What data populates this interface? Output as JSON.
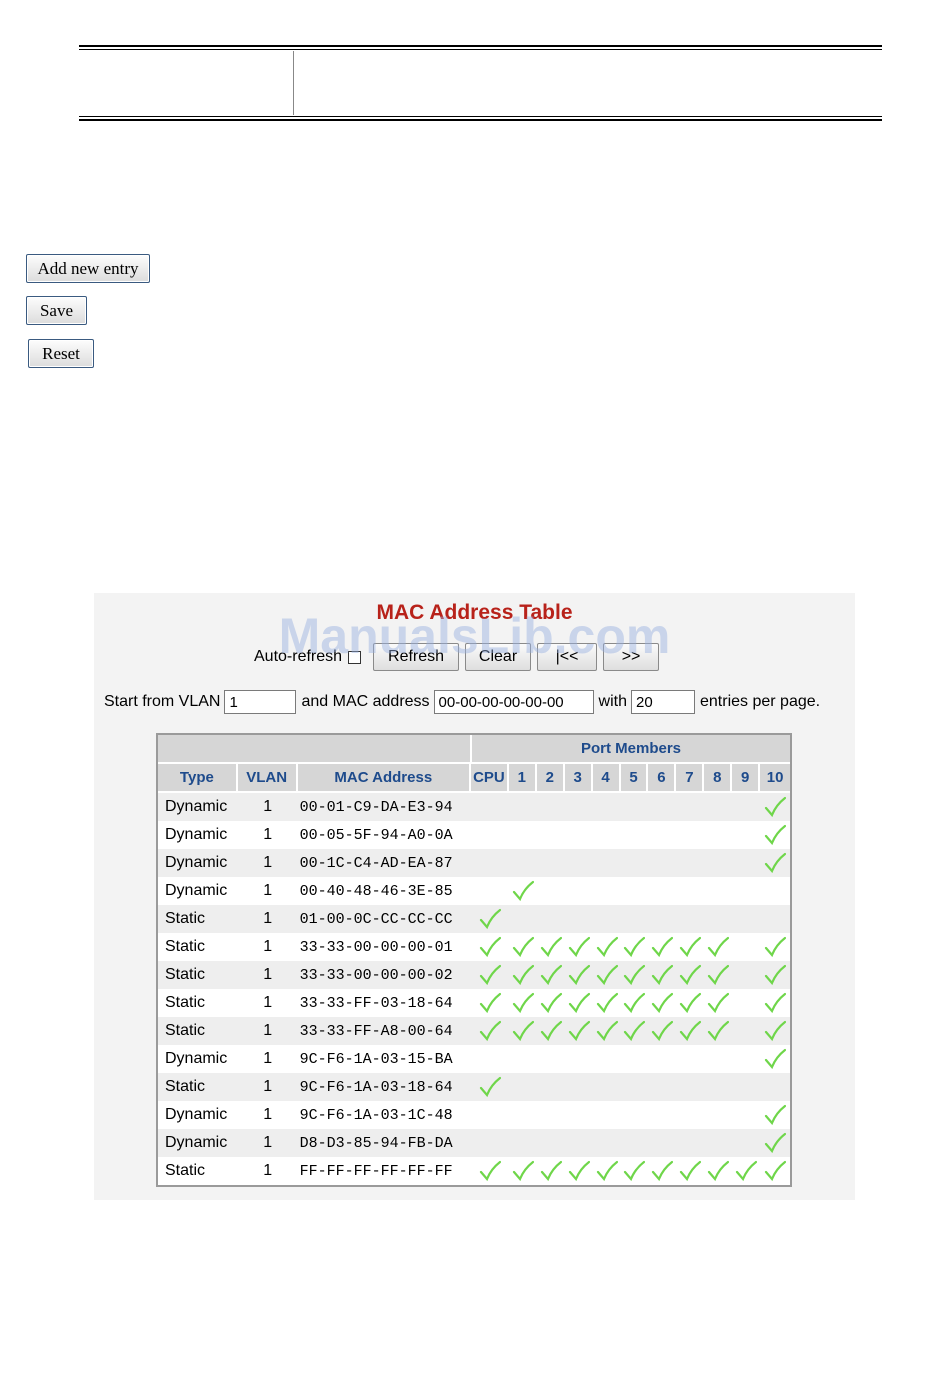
{
  "doc_buttons": {
    "add_new_entry": "Add new entry",
    "save": "Save",
    "reset": "Reset"
  },
  "panel": {
    "title": "MAC Address Table",
    "watermark": "ManualsLib.com",
    "auto_refresh_label": "Auto-refresh",
    "auto_refresh_checked": false,
    "buttons": {
      "refresh": "Refresh",
      "clear": "Clear",
      "prev": "|<<",
      "next": ">>"
    },
    "filter": {
      "start_label": "Start from VLAN",
      "vlan_value": "1",
      "mac_label": "and MAC address",
      "mac_value": "00-00-00-00-00-00",
      "with_label": "with",
      "entries_value": "20",
      "entries_label": "entries per page."
    }
  },
  "table": {
    "group_header": "Port Members",
    "columns": [
      "Type",
      "VLAN",
      "MAC Address",
      "CPU",
      "1",
      "2",
      "3",
      "4",
      "5",
      "6",
      "7",
      "8",
      "9",
      "10"
    ],
    "check_color": "#6fd64a",
    "header_text_color": "#1e4b8c",
    "title_color": "#b8221a",
    "rows": [
      {
        "type": "Dynamic",
        "vlan": "1",
        "mac": "00-01-C9-DA-E3-94",
        "ports": [
          0,
          0,
          0,
          0,
          0,
          0,
          0,
          0,
          0,
          0,
          1
        ]
      },
      {
        "type": "Dynamic",
        "vlan": "1",
        "mac": "00-05-5F-94-A0-0A",
        "ports": [
          0,
          0,
          0,
          0,
          0,
          0,
          0,
          0,
          0,
          0,
          1
        ]
      },
      {
        "type": "Dynamic",
        "vlan": "1",
        "mac": "00-1C-C4-AD-EA-87",
        "ports": [
          0,
          0,
          0,
          0,
          0,
          0,
          0,
          0,
          0,
          0,
          1
        ]
      },
      {
        "type": "Dynamic",
        "vlan": "1",
        "mac": "00-40-48-46-3E-85",
        "ports": [
          0,
          1,
          0,
          0,
          0,
          0,
          0,
          0,
          0,
          0,
          0
        ]
      },
      {
        "type": "Static",
        "vlan": "1",
        "mac": "01-00-0C-CC-CC-CC",
        "ports": [
          1,
          0,
          0,
          0,
          0,
          0,
          0,
          0,
          0,
          0,
          0
        ]
      },
      {
        "type": "Static",
        "vlan": "1",
        "mac": "33-33-00-00-00-01",
        "ports": [
          1,
          1,
          1,
          1,
          1,
          1,
          1,
          1,
          1,
          0,
          1
        ]
      },
      {
        "type": "Static",
        "vlan": "1",
        "mac": "33-33-00-00-00-02",
        "ports": [
          1,
          1,
          1,
          1,
          1,
          1,
          1,
          1,
          1,
          0,
          1
        ]
      },
      {
        "type": "Static",
        "vlan": "1",
        "mac": "33-33-FF-03-18-64",
        "ports": [
          1,
          1,
          1,
          1,
          1,
          1,
          1,
          1,
          1,
          0,
          1
        ]
      },
      {
        "type": "Static",
        "vlan": "1",
        "mac": "33-33-FF-A8-00-64",
        "ports": [
          1,
          1,
          1,
          1,
          1,
          1,
          1,
          1,
          1,
          0,
          1
        ]
      },
      {
        "type": "Dynamic",
        "vlan": "1",
        "mac": "9C-F6-1A-03-15-BA",
        "ports": [
          0,
          0,
          0,
          0,
          0,
          0,
          0,
          0,
          0,
          0,
          1
        ]
      },
      {
        "type": "Static",
        "vlan": "1",
        "mac": "9C-F6-1A-03-18-64",
        "ports": [
          1,
          0,
          0,
          0,
          0,
          0,
          0,
          0,
          0,
          0,
          0
        ]
      },
      {
        "type": "Dynamic",
        "vlan": "1",
        "mac": "9C-F6-1A-03-1C-48",
        "ports": [
          0,
          0,
          0,
          0,
          0,
          0,
          0,
          0,
          0,
          0,
          1
        ]
      },
      {
        "type": "Dynamic",
        "vlan": "1",
        "mac": "D8-D3-85-94-FB-DA",
        "ports": [
          0,
          0,
          0,
          0,
          0,
          0,
          0,
          0,
          0,
          0,
          1
        ]
      },
      {
        "type": "Static",
        "vlan": "1",
        "mac": "FF-FF-FF-FF-FF-FF",
        "ports": [
          1,
          1,
          1,
          1,
          1,
          1,
          1,
          1,
          1,
          1,
          1
        ]
      }
    ]
  }
}
